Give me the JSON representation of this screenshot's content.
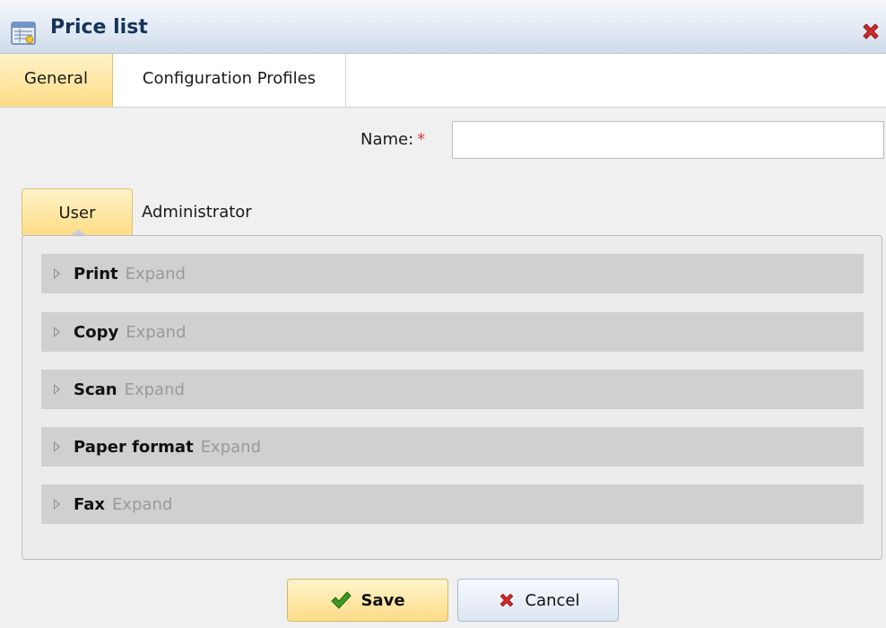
{
  "window": {
    "title": "Price list",
    "icon": "price-list-icon",
    "close_icon": "close-icon"
  },
  "top_tabs": [
    {
      "label": "General",
      "active": true
    },
    {
      "label": "Configuration Profiles",
      "active": false
    }
  ],
  "form": {
    "name_label": "Name:",
    "required_marker": "*",
    "name_value": ""
  },
  "inner_tabs": [
    {
      "label": "User",
      "active": true
    },
    {
      "label": "Administrator",
      "active": false
    }
  ],
  "sections": [
    {
      "title": "Print",
      "action": "Expand"
    },
    {
      "title": "Copy",
      "action": "Expand"
    },
    {
      "title": "Scan",
      "action": "Expand"
    },
    {
      "title": "Paper format",
      "action": "Expand"
    },
    {
      "title": "Fax",
      "action": "Expand"
    }
  ],
  "buttons": {
    "save_label": "Save",
    "save_icon": "checkmark-icon",
    "cancel_label": "Cancel",
    "cancel_icon": "x-icon"
  },
  "colors": {
    "accent_active_tab": "#fddc86",
    "required": "#d43a3a",
    "close": "#d42a2a",
    "check": "#3c9a1e"
  }
}
